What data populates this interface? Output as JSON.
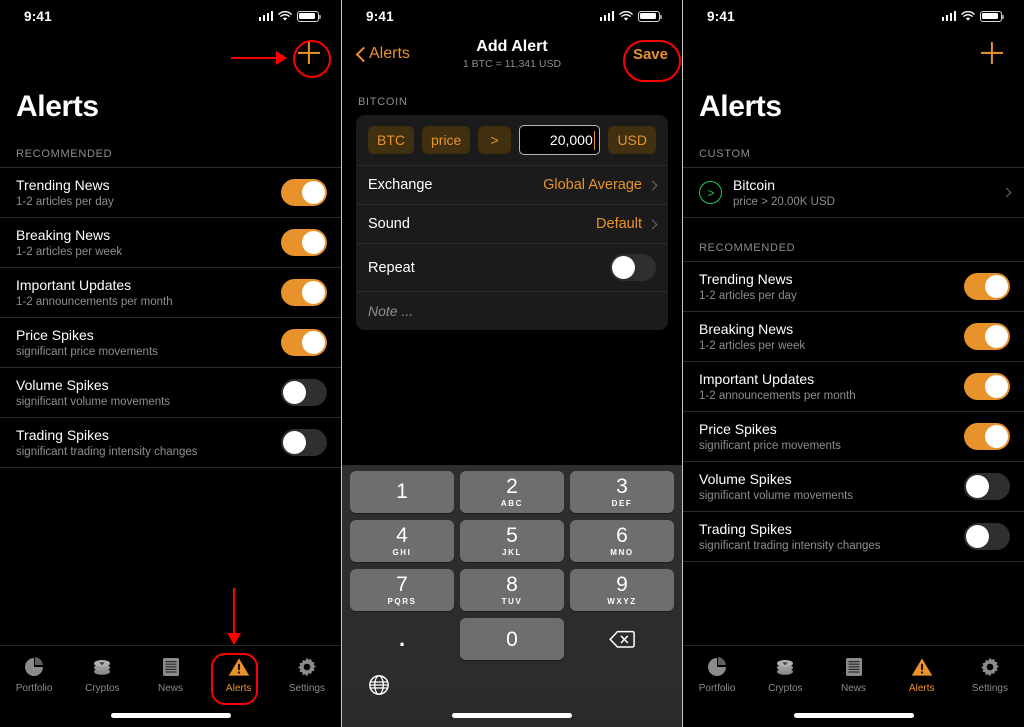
{
  "statusbar": {
    "time": "9:41"
  },
  "panel1": {
    "title": "Alerts",
    "add_icon": "plus-icon",
    "section_label": "RECOMMENDED",
    "rows": [
      {
        "title": "Trending News",
        "sub": "1-2 articles per day",
        "on": true
      },
      {
        "title": "Breaking News",
        "sub": "1-2 articles per week",
        "on": true
      },
      {
        "title": "Important Updates",
        "sub": "1-2 announcements per month",
        "on": true
      },
      {
        "title": "Price Spikes",
        "sub": "significant price movements",
        "on": true
      },
      {
        "title": "Volume Spikes",
        "sub": "significant volume movements",
        "on": false
      },
      {
        "title": "Trading Spikes",
        "sub": "significant trading intensity changes",
        "on": false
      }
    ]
  },
  "panel2": {
    "back_label": "Alerts",
    "nav_title": "Add Alert",
    "nav_subtitle": "1 BTC = 11,341 USD",
    "save_label": "Save",
    "section_label": "BITCOIN",
    "condition": {
      "asset_pill": "BTC",
      "metric_pill": "price",
      "operator_pill": ">",
      "amount_value": "20,000",
      "currency_pill": "USD"
    },
    "rows": [
      {
        "label": "Exchange",
        "value": "Global Average"
      },
      {
        "label": "Sound",
        "value": "Default"
      }
    ],
    "repeat_label": "Repeat",
    "repeat_on": false,
    "note_placeholder": "Note ...",
    "keyboard": {
      "keys": [
        {
          "num": "1",
          "abc": ""
        },
        {
          "num": "2",
          "abc": "ABC"
        },
        {
          "num": "3",
          "abc": "DEF"
        },
        {
          "num": "4",
          "abc": "GHI"
        },
        {
          "num": "5",
          "abc": "JKL"
        },
        {
          "num": "6",
          "abc": "MNO"
        },
        {
          "num": "7",
          "abc": "PQRS"
        },
        {
          "num": "8",
          "abc": "TUV"
        },
        {
          "num": "9",
          "abc": "WXYZ"
        }
      ],
      "dot": ".",
      "zero": "0",
      "backspace_icon": "backspace-icon",
      "globe_icon": "globe-icon"
    }
  },
  "panel3": {
    "title": "Alerts",
    "add_icon": "plus-icon",
    "custom_label": "CUSTOM",
    "custom_alert": {
      "title": "Bitcoin",
      "sub": "price > 20.00K USD",
      "icon": "greater-than-circle-icon"
    },
    "section_label": "RECOMMENDED",
    "rows": [
      {
        "title": "Trending News",
        "sub": "1-2 articles per day",
        "on": true
      },
      {
        "title": "Breaking News",
        "sub": "1-2 articles per week",
        "on": true
      },
      {
        "title": "Important Updates",
        "sub": "1-2 announcements per month",
        "on": true
      },
      {
        "title": "Price Spikes",
        "sub": "significant price movements",
        "on": true
      },
      {
        "title": "Volume Spikes",
        "sub": "significant volume movements",
        "on": false
      },
      {
        "title": "Trading Spikes",
        "sub": "significant trading intensity changes",
        "on": false
      }
    ]
  },
  "tabbar": {
    "tabs": [
      {
        "label": "Portfolio",
        "icon": "pie-chart-icon",
        "active": false
      },
      {
        "label": "Cryptos",
        "icon": "coins-icon",
        "active": false
      },
      {
        "label": "News",
        "icon": "document-icon",
        "active": false
      },
      {
        "label": "Alerts",
        "icon": "warning-icon",
        "active": true
      },
      {
        "label": "Settings",
        "icon": "gear-icon",
        "active": false
      }
    ]
  },
  "colors": {
    "accent": "#e8922b",
    "annotation": "#ff0000",
    "green": "#1fc75c",
    "background": "#000000",
    "card": "#1b1b1b",
    "pill": "#40300f"
  }
}
